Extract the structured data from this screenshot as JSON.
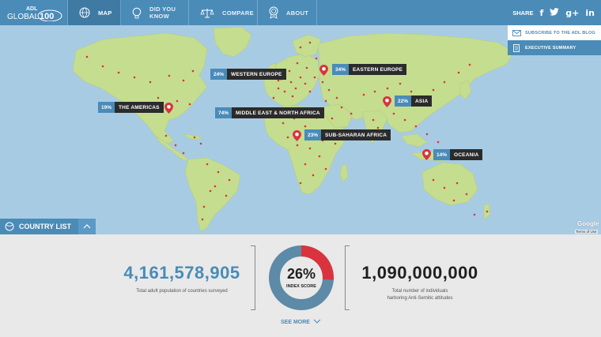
{
  "nav": {
    "logo_text_top": "ADL",
    "logo_text_main": "GLOBAL",
    "logo_text_num": "100",
    "tabs": [
      {
        "label": "MAP",
        "icon": "globe-icon"
      },
      {
        "label": "DID YOU KNOW",
        "icon": "lightbulb-icon"
      },
      {
        "label": "COMPARE",
        "icon": "scales-icon"
      },
      {
        "label": "ABOUT",
        "icon": "award-icon"
      }
    ],
    "share_label": "SHARE",
    "share_icons": [
      {
        "glyph": "f",
        "icon": "facebook-icon"
      },
      {
        "glyph": "🐦",
        "icon": "twitter-icon"
      },
      {
        "glyph": "g+",
        "icon": "google-plus-icon"
      },
      {
        "glyph": "in",
        "icon": "linkedin-icon"
      }
    ]
  },
  "side": {
    "subscribe_label": "SUBSCRIBE TO THE ADL BLOG",
    "executive_label": "EXECUTIVE SUMMARY"
  },
  "regions": [
    {
      "pct": "24%",
      "name": "WESTERN EUROPE"
    },
    {
      "pct": "34%",
      "name": "EASTERN EUROPE"
    },
    {
      "pct": "19%",
      "name": "THE AMERICAS"
    },
    {
      "pct": "74%",
      "name": "MIDDLE EAST & NORTH AFRICA"
    },
    {
      "pct": "22%",
      "name": "ASIA"
    },
    {
      "pct": "23%",
      "name": "SUB-SAHARAN AFRICA"
    },
    {
      "pct": "14%",
      "name": "OCEANIA"
    }
  ],
  "country_list_label": "COUNTRY LIST",
  "map_attribution": {
    "google": "Google",
    "terms": "Terms of Use"
  },
  "stats": {
    "population_value": "4,161,578,905",
    "population_caption": "Total adult population of countries surveyed",
    "index_value": "26%",
    "index_label": "INDEX SCORE",
    "index_fraction": 0.26,
    "individuals_value": "1,090,000,000",
    "individuals_caption_1": "Total number of individuals",
    "individuals_caption_2": "harboring Anti-Semitic attitudes",
    "see_more_label": "SEE MORE"
  },
  "colors": {
    "brand_blue": "#4a8bb8",
    "ocean": "#a8cbe4",
    "land": "#c5dd8f",
    "marker_red": "#d9343d",
    "donut_gray": "#5d8aa6",
    "label_dark": "#2b2b2b"
  }
}
